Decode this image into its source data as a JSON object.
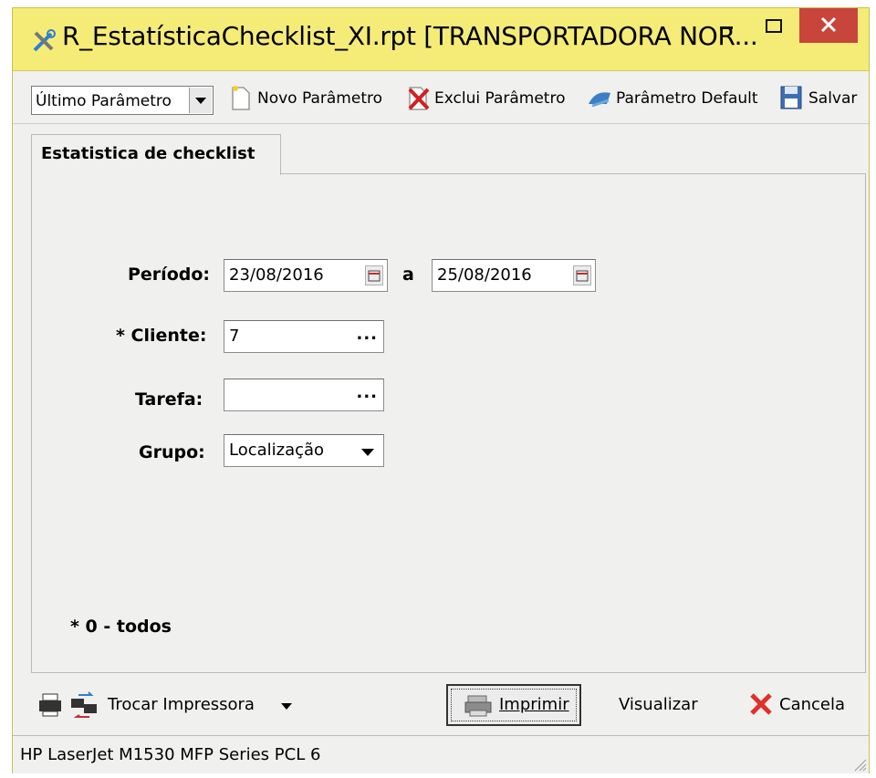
{
  "window": {
    "title": "R_EstatísticaChecklist_XI.rpt [TRANSPORTADORA NOR...",
    "accent": "#f5ec78",
    "close_color": "#c8453b"
  },
  "toolbar": {
    "param_select": "Último Parâmetro",
    "novo": "Novo Parâmetro",
    "exclui": "Exclui Parâmetro",
    "default": "Parâmetro Default",
    "salvar": "Salvar"
  },
  "tab": {
    "label": "Estatistica de checklist"
  },
  "form": {
    "periodo_label": "Período:",
    "date_from": "23/08/2016",
    "periodo_sep": "a",
    "date_to": "25/08/2016",
    "cliente_label": "* Cliente:",
    "cliente_value": "7",
    "tarefa_label": "Tarefa:",
    "tarefa_value": "",
    "grupo_label": "Grupo:",
    "grupo_value": "Localização",
    "ellipsis": "...",
    "note": "* 0 - todos"
  },
  "bottom": {
    "trocar": "Trocar Impressora",
    "imprimir": "Imprimir",
    "visualizar": "Visualizar",
    "cancela": "Cancela"
  },
  "status": {
    "printer": "HP LaserJet M1530 MFP Series PCL 6"
  },
  "icons": {
    "app": "tools-icon",
    "minimize": "minimize-icon",
    "maximize": "maximize-icon",
    "close": "close-icon",
    "novo": "new-document-icon",
    "exclui": "delete-document-icon",
    "default": "default-arrow-icon",
    "salvar": "floppy-disk-icon",
    "printer": "printer-icon",
    "swap": "swap-printer-icon",
    "cancel": "red-x-icon",
    "calendar": "calendar-icon"
  }
}
